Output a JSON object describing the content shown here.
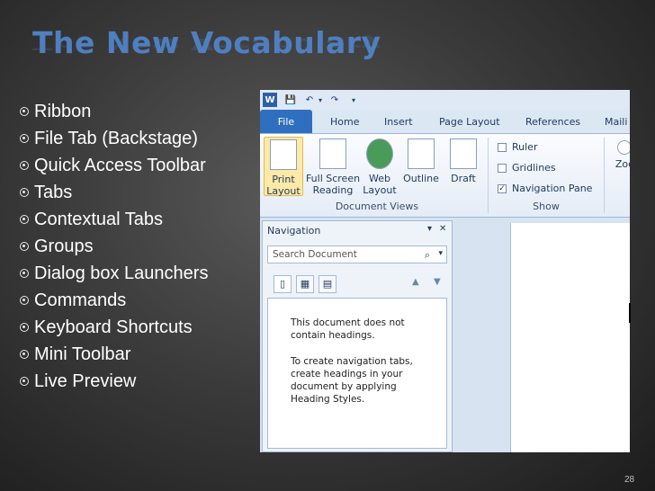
{
  "slide": {
    "title": "The New Vocabulary",
    "bullets": [
      "Ribbon",
      "File Tab (Backstage)",
      "Quick Access Toolbar",
      "Tabs",
      "Contextual Tabs",
      "Groups",
      "Dialog box Launchers",
      "Commands",
      "Keyboard Shortcuts",
      "Mini Toolbar",
      "Live Preview"
    ],
    "slide_number": "28"
  },
  "qat": {
    "word_icon": "W",
    "save_icon": "💾",
    "undo_icon": "↶",
    "undo_dropdown": "▾",
    "redo_icon": "↷",
    "customize_icon": "▾"
  },
  "ribbon": {
    "tabs": [
      "File",
      "Home",
      "Insert",
      "Page Layout",
      "References",
      "Maili"
    ],
    "document_views": {
      "label": "Document Views",
      "buttons": [
        {
          "line1": "Print",
          "line2": "Layout"
        },
        {
          "line1": "Full Screen",
          "line2": "Reading"
        },
        {
          "line1": "Web",
          "line2": "Layout"
        },
        {
          "line1": "Outline",
          "line2": ""
        },
        {
          "line1": "Draft",
          "line2": ""
        }
      ]
    },
    "show": {
      "label": "Show",
      "items": [
        {
          "label": "Ruler",
          "checked": false
        },
        {
          "label": "Gridlines",
          "checked": false
        },
        {
          "label": "Navigation Pane",
          "checked": true
        }
      ]
    },
    "zoom": {
      "label": "Zoc"
    }
  },
  "navigation_pane": {
    "title": "Navigation",
    "dropdown_icon": "▾",
    "close_icon": "✕",
    "search_placeholder": "Search Document",
    "search_icon": "⌕",
    "search_dropdown": "▾",
    "view_tabs": [
      "headings-view",
      "pages-view",
      "results-view"
    ],
    "up_arrow": "▲",
    "down_arrow": "▼",
    "message_1": "This document does not contain headings.",
    "message_2": "To create navigation tabs, create headings in your document by applying Heading Styles."
  },
  "colors": {
    "title": "#4f7fbf",
    "file_tab": "#2f6fbf",
    "ribbon_bg": "#d7e3f1"
  }
}
